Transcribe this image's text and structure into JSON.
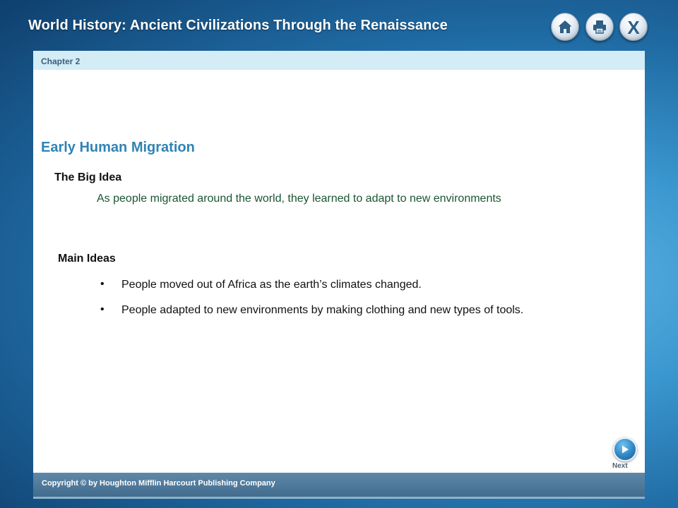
{
  "header": {
    "title": "World History: Ancient Civilizations Through the Renaissance",
    "buttons": [
      {
        "icon": "home-icon"
      },
      {
        "icon": "print-icon"
      },
      {
        "icon": "close-icon",
        "glyph": "X"
      }
    ]
  },
  "chapter": {
    "label": "Chapter 2"
  },
  "slide": {
    "title": "Early Human Migration",
    "big_idea": {
      "heading": "The Big Idea",
      "text": "As people migrated around the world, they learned to adapt to new environments"
    },
    "main_ideas": {
      "heading": "Main Ideas",
      "bullet": "•",
      "items": [
        "People moved out of Africa as the earth’s climates changed.",
        "People adapted to new environments by making clothing and new types of tools."
      ]
    }
  },
  "navigation": {
    "next_label": "Next",
    "next_icon": "play-arrow-icon"
  },
  "footer": {
    "copyright": "Copyright © by Houghton Mifflin Harcourt Publishing Company"
  },
  "colors": {
    "title_blue": "#2f83b6",
    "big_idea_green": "#1a5530",
    "chapter_bar": "#d3ecf6",
    "footer_bar": "#426c8e"
  }
}
